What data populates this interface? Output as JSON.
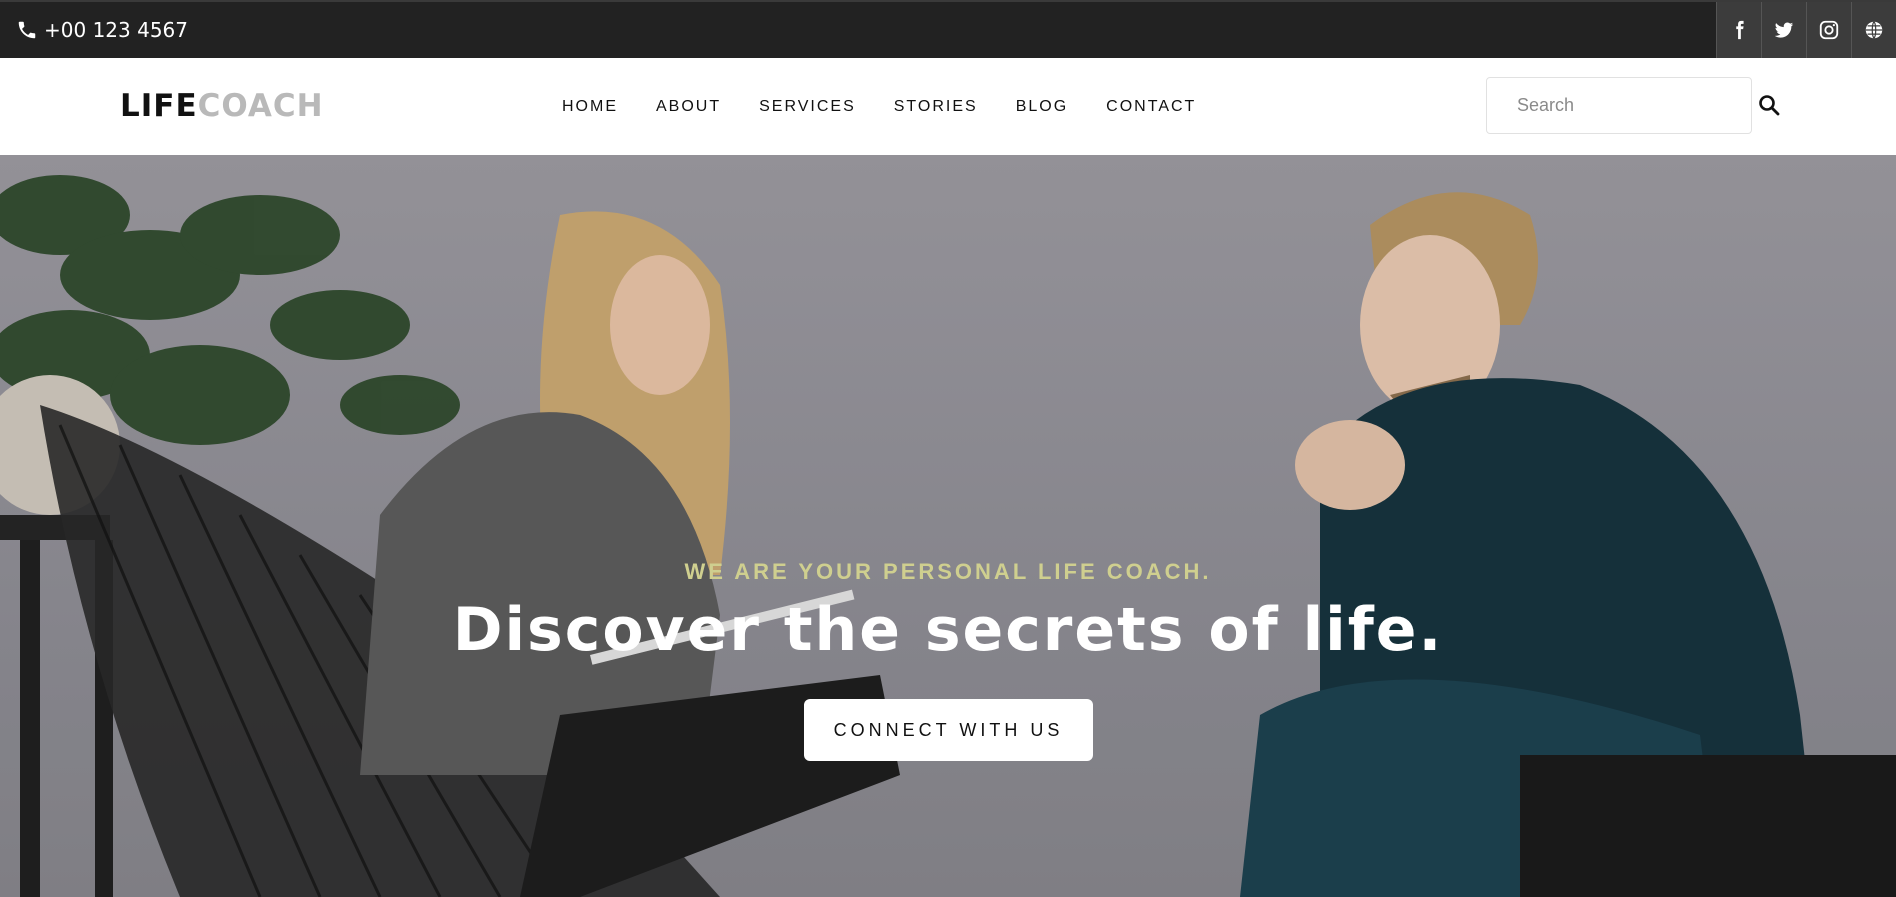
{
  "topbar": {
    "phone": "+00 123 4567",
    "social": [
      {
        "name": "facebook-icon",
        "label": "Facebook"
      },
      {
        "name": "twitter-icon",
        "label": "Twitter"
      },
      {
        "name": "instagram-icon",
        "label": "Instagram"
      },
      {
        "name": "globe-icon",
        "label": "Website"
      }
    ]
  },
  "navbar": {
    "logo_part1": "LIFE",
    "logo_part2": "COACH",
    "menu": [
      "HOME",
      "ABOUT",
      "SERVICES",
      "STORIES",
      "BLOG",
      "CONTACT"
    ],
    "search_placeholder": "Search"
  },
  "hero": {
    "eyebrow": "WE ARE YOUR PERSONAL LIFE COACH.",
    "headline": "Discover the secrets of life.",
    "cta": "CONNECT WITH US"
  },
  "colors": {
    "topbar": "#222222",
    "accent": "#cfcf8f",
    "logo_gray": "#b9b9b9"
  }
}
